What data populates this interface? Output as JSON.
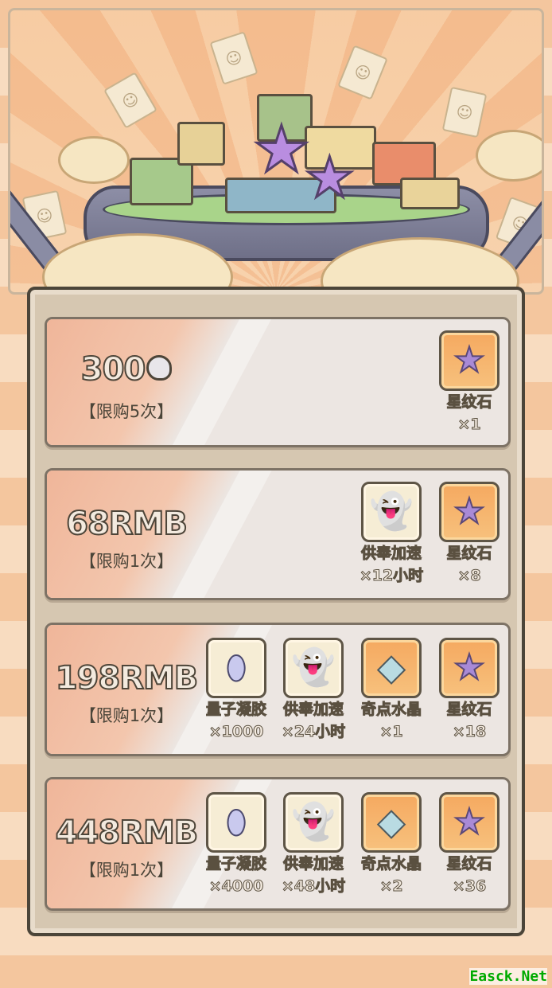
{
  "offers": [
    {
      "price": "300",
      "currency_icon": "ghost-coin-icon",
      "limit": "【限购5次】",
      "items": [
        {
          "icon": "star-stone-icon",
          "bg": "orange",
          "name": "星纹石",
          "qty": "×1"
        }
      ]
    },
    {
      "price": "68RMB",
      "limit": "【限购1次】",
      "items": [
        {
          "icon": "ghost-icon",
          "bg": "cream",
          "name": "供奉加速",
          "qty": "×12小时"
        },
        {
          "icon": "star-stone-icon",
          "bg": "orange",
          "name": "星纹石",
          "qty": "×8"
        }
      ]
    },
    {
      "price": "198RMB",
      "limit": "【限购1次】",
      "items": [
        {
          "icon": "quantum-gel-icon",
          "bg": "cream",
          "name": "量子凝胶",
          "qty": "×1000"
        },
        {
          "icon": "ghost-icon",
          "bg": "cream",
          "name": "供奉加速",
          "qty": "×24小时"
        },
        {
          "icon": "crystal-icon",
          "bg": "orange",
          "name": "奇点水晶",
          "qty": "×1"
        },
        {
          "icon": "star-stone-icon",
          "bg": "orange",
          "name": "星纹石",
          "qty": "×18"
        }
      ]
    },
    {
      "price": "448RMB",
      "limit": "【限购1次】",
      "items": [
        {
          "icon": "quantum-gel-icon",
          "bg": "cream",
          "name": "量子凝胶",
          "qty": "×4000"
        },
        {
          "icon": "ghost-icon",
          "bg": "cream",
          "name": "供奉加速",
          "qty": "×48小时"
        },
        {
          "icon": "crystal-icon",
          "bg": "orange",
          "name": "奇点水晶",
          "qty": "×2"
        },
        {
          "icon": "star-stone-icon",
          "bg": "orange",
          "name": "星纹石",
          "qty": "×36"
        }
      ]
    }
  ],
  "watermark": "Easck.Net"
}
